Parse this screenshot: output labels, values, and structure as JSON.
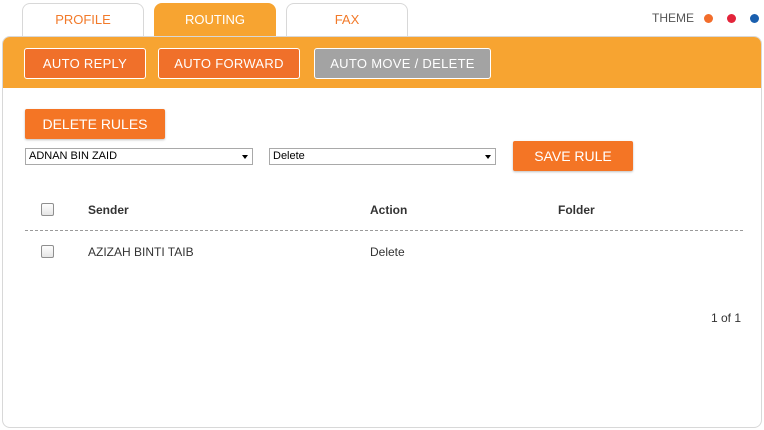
{
  "tabs": [
    {
      "label": "PROFILE",
      "active": false
    },
    {
      "label": "ROUTING",
      "active": true
    },
    {
      "label": "FAX",
      "active": false
    }
  ],
  "theme": {
    "label": "THEME",
    "colors": [
      "#f26d2b",
      "#e3243a",
      "#1a5fae"
    ]
  },
  "subnav": {
    "auto_reply": "AUTO REPLY",
    "auto_forward": "AUTO FORWARD",
    "auto_move_delete": "AUTO MOVE / DELETE"
  },
  "toolbar": {
    "delete_rules": "DELETE RULES",
    "sender_select_value": "ADNAN BIN ZAID",
    "action_select_value": "Delete",
    "save_rule": "SAVE RULE"
  },
  "table": {
    "headers": {
      "sender": "Sender",
      "action": "Action",
      "folder": "Folder"
    },
    "rows": [
      {
        "sender": "AZIZAH BINTI TAIB",
        "action": "Delete",
        "folder": ""
      }
    ]
  },
  "pagination": "1 of 1",
  "colors": {
    "accent": "#f7a431",
    "button": "#f47525",
    "active_subtab": "#a3a3a3"
  }
}
